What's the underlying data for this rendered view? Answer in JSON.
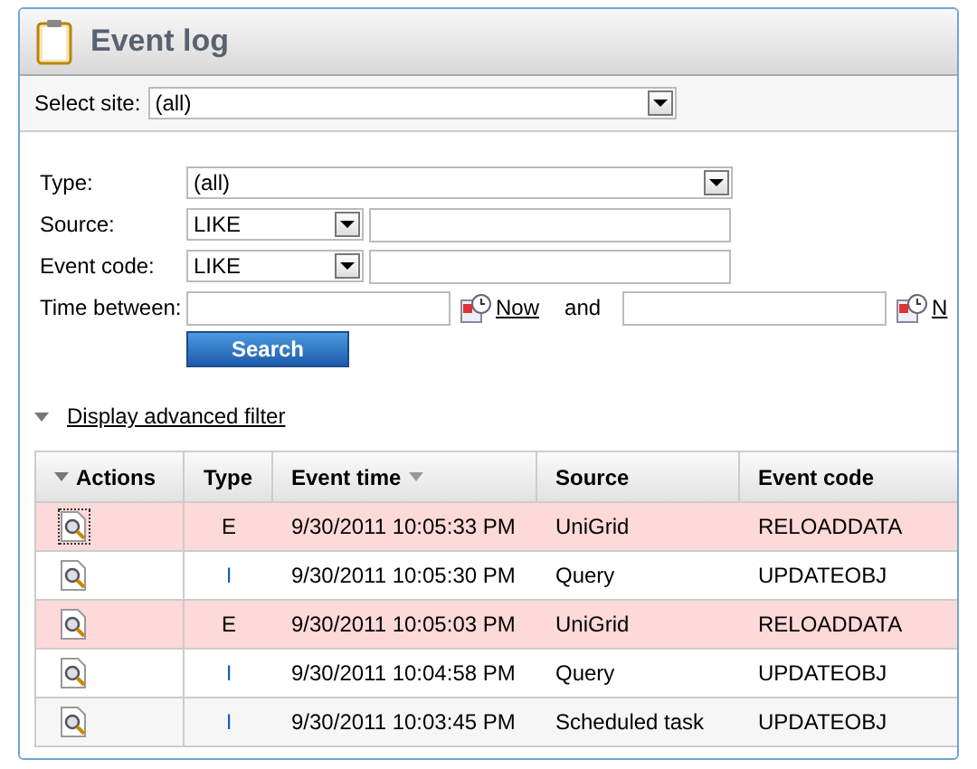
{
  "header": {
    "title": "Event log"
  },
  "site": {
    "label": "Select site:",
    "value": "(all)"
  },
  "filters": [
    {
      "kind": "select",
      "label": "Type:",
      "value": "(all)"
    },
    {
      "kind": "like",
      "label": "Source:",
      "value": "LIKE"
    },
    {
      "kind": "like",
      "label": "Event code:",
      "value": "LIKE"
    }
  ],
  "time": {
    "label": "Time between:",
    "now_1": "Now",
    "and": "and",
    "now_2": "N"
  },
  "search_button": "Search",
  "advanced_filter": "Display advanced filter",
  "table": {
    "columns": [
      {
        "label": "Actions",
        "kind": "menu"
      },
      {
        "label": "Type",
        "kind": "plain"
      },
      {
        "label": "Event time",
        "kind": "sorted"
      },
      {
        "label": "Source",
        "kind": "plain"
      },
      {
        "label": "Event code",
        "kind": "plain"
      }
    ],
    "rows": [
      {
        "kind": "error",
        "type": "E",
        "time": "9/30/2011 10:05:33 PM",
        "source": "UniGrid",
        "code": "RELOADDATA",
        "focused": true
      },
      {
        "kind": "info",
        "type": "I",
        "time": "9/30/2011 10:05:30 PM",
        "source": "Query",
        "code": "UPDATEOBJ",
        "focused": false
      },
      {
        "kind": "error",
        "type": "E",
        "time": "9/30/2011 10:05:03 PM",
        "source": "UniGrid",
        "code": "RELOADDATA",
        "focused": false
      },
      {
        "kind": "info",
        "type": "I",
        "time": "9/30/2011 10:04:58 PM",
        "source": "Query",
        "code": "UPDATEOBJ",
        "focused": false
      },
      {
        "kind": "info",
        "type": "I",
        "time": "9/30/2011 10:03:45 PM",
        "source": "Scheduled task",
        "code": "UPDATEOBJ",
        "focused": false
      }
    ]
  }
}
